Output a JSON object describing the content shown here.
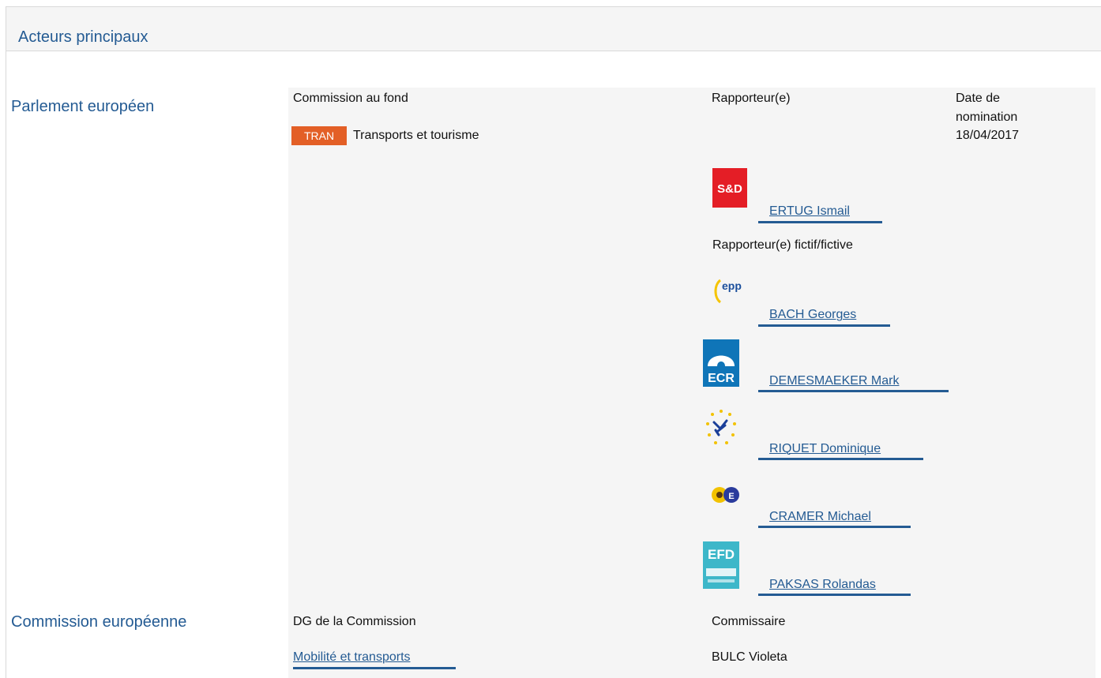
{
  "panel": {
    "title": "Acteurs principaux"
  },
  "parliament": {
    "label": "Parlement européen",
    "col_committee": "Commission au fond",
    "col_rapporteur": "Rapporteur(e)",
    "col_date_line1": "Date de",
    "col_date_line2": "nomination",
    "committee_code": "TRAN",
    "committee_name": "Transports et tourisme",
    "date": "18/04/2017",
    "rapporteur": {
      "name": "ERTUG Ismail",
      "group": "S&D",
      "group_color": "#e41e26"
    },
    "shadow_label": "Rapporteur(e) fictif/fictive",
    "shadows": [
      {
        "name": "BACH Georges",
        "group": "epp"
      },
      {
        "name": "DEMESMAEKER Mark",
        "group": "ECR"
      },
      {
        "name": "RIQUET Dominique",
        "group": "ALDE"
      },
      {
        "name": "CRAMER Michael",
        "group": "Verts/ALE"
      },
      {
        "name": "PAKSAS Rolandas",
        "group": "EFD"
      }
    ]
  },
  "commission": {
    "label": "Commission européenne",
    "col_dg": "DG de la Commission",
    "col_commissioner": "Commissaire",
    "dg": "Mobilité et transports",
    "commissioner": "BULC Violeta"
  },
  "colors": {
    "link": "#245b93",
    "badge": "#e35f26",
    "panel_bg": "#f5f5f5"
  }
}
